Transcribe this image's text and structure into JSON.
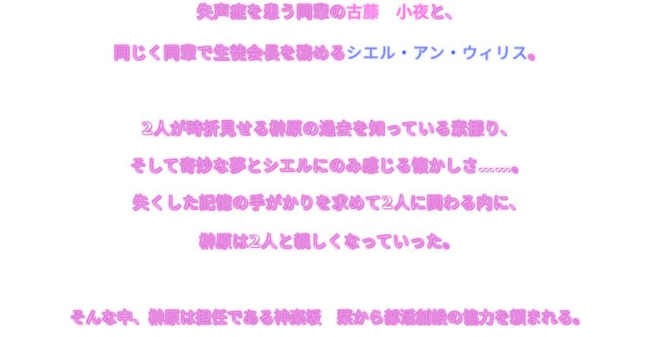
{
  "story": {
    "line1": {
      "before": "失声症を患う同輩の",
      "name": "古藤　小夜",
      "after": "と、"
    },
    "line2": {
      "before": "同じく同輩で生徒会長を務める",
      "name": "シエル・アン・ウィリス",
      "after": "。"
    },
    "line3": "2人が時折見せる榊原の過去を知っている素振り、",
    "line4": "そして奇妙な夢とシエルにのみ感じる懐かしさ……。",
    "line5": "失くした記憶の手がかりを求めて2人に関わる内に、",
    "line6": "榊原は2人と親しくなっていった。",
    "line7": "そんな中、榊原は担任である神楽坂　栞から部活創設の協力を頼まれる。"
  },
  "colors": {
    "text_fill": "#ffffff",
    "text_glow": "#e06bd8",
    "name_pink": "#e040c8",
    "name_blue": "#3c4cff"
  }
}
